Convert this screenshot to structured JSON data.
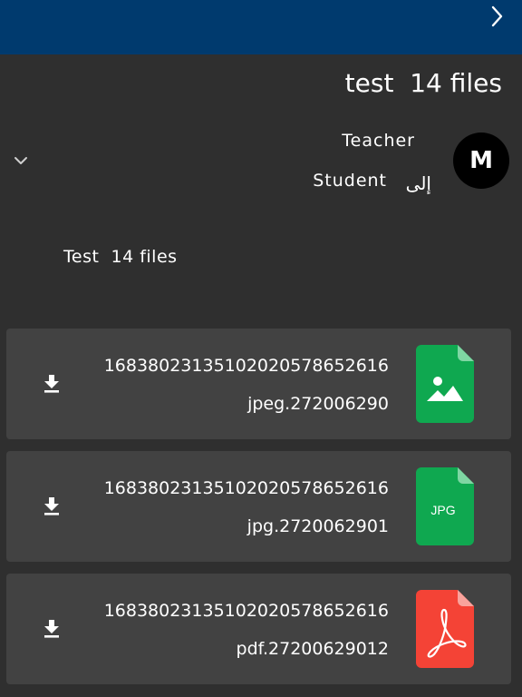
{
  "header": {
    "forward_icon": "chevron-right-icon",
    "title": "test  14 files"
  },
  "colors": {
    "header_bg": "#003a6e",
    "page_bg": "#2f2f2f",
    "card_bg": "#424242",
    "image_icon": "#0fa850",
    "jpg_icon": "#0fa850",
    "pdf_icon": "#f44336"
  },
  "message": {
    "expand_icon": "chevron-down-icon",
    "from": "Teacher",
    "to_prefix": "إلى",
    "to": "Student",
    "avatar_initial": "M",
    "body": "Test  14 files"
  },
  "files": [
    {
      "name_line1": "16838023135102020578652616",
      "name_line2": "jpeg.272006290",
      "icon": "image-file-icon",
      "download_icon": "download-icon"
    },
    {
      "name_line1": "16838023135102020578652616",
      "name_line2": "jpg.2720062901",
      "icon": "jpg-file-icon",
      "icon_text": "JPG",
      "download_icon": "download-icon"
    },
    {
      "name_line1": "16838023135102020578652616",
      "name_line2": "pdf.27200629012",
      "icon": "pdf-file-icon",
      "download_icon": "download-icon"
    }
  ]
}
